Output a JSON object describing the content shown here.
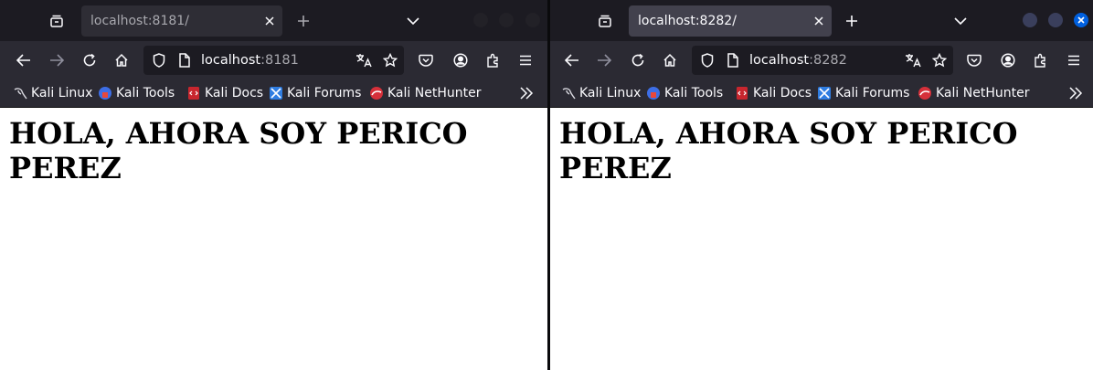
{
  "windows": [
    {
      "tab_title": "localhost:8181/",
      "url_host": "localhost",
      "url_port": ":8181",
      "heading": "HOLA, AHORA SOY PERICO PEREZ"
    },
    {
      "tab_title": "localhost:8282/",
      "url_host": "localhost",
      "url_port": ":8282",
      "heading": "HOLA, AHORA SOY PERICO PEREZ"
    }
  ],
  "bookmarks": [
    "Kali Linux",
    "Kali Tools",
    "Kali Docs",
    "Kali Forums",
    "Kali NetHunter"
  ],
  "icons": {
    "tab_bar": [
      "tab-overview-icon",
      "new-tab-icon",
      "tab-list-icon"
    ],
    "nav": [
      "back-icon",
      "forward-icon",
      "reload-icon",
      "home-icon",
      "shield-icon",
      "page-icon",
      "translate-icon",
      "star-icon",
      "pocket-icon",
      "account-icon",
      "extensions-icon",
      "menu-icon"
    ],
    "window_controls": [
      "minimize-icon",
      "maximize-icon",
      "close-window-icon"
    ]
  },
  "colors": {
    "toolbar": "#2b2a33",
    "tabbar": "#1c1b22",
    "active_tab": "#42414d",
    "close_button": "#0060df",
    "page_bg": "#ffffff"
  }
}
